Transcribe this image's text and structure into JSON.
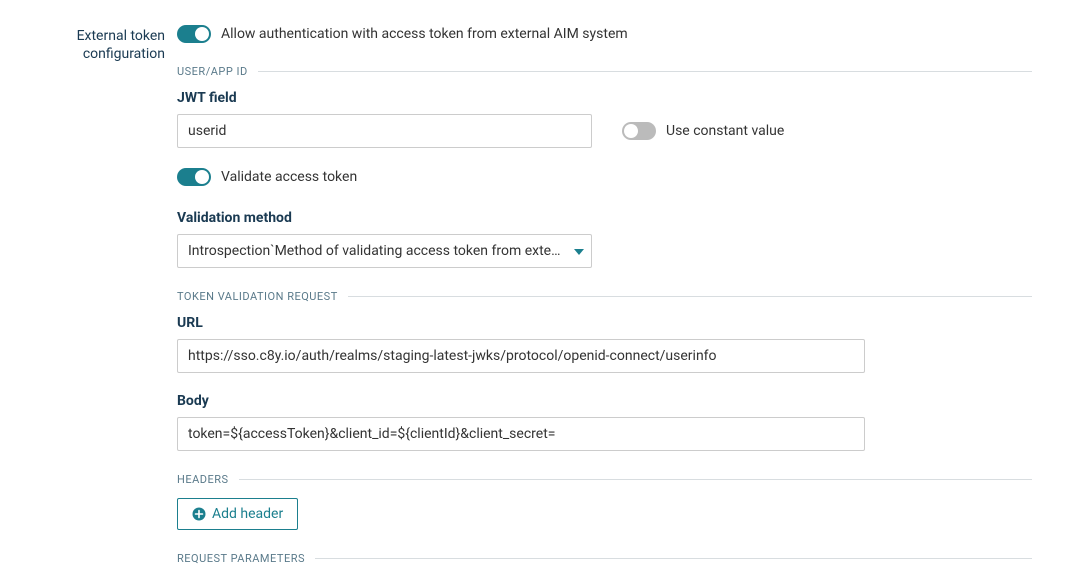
{
  "title": "External token configuration",
  "allowAuth": {
    "label": "Allow authentication with access token from external AIM system",
    "on": true
  },
  "sections": {
    "userAppId": "USER/APP ID",
    "tokenValidationRequest": "TOKEN VALIDATION REQUEST",
    "headers": "HEADERS",
    "requestParameters": "REQUEST PARAMETERS"
  },
  "jwtField": {
    "label": "JWT field",
    "value": "userid"
  },
  "useConstant": {
    "label": "Use constant value",
    "on": false
  },
  "validateToken": {
    "label": "Validate access token",
    "on": true
  },
  "validationMethod": {
    "label": "Validation method",
    "value": "Introspection`Method of validating access token from external AIM system"
  },
  "url": {
    "label": "URL",
    "value": "https://sso.c8y.io/auth/realms/staging-latest-jwks/protocol/openid-connect/userinfo"
  },
  "body": {
    "label": "Body",
    "value": "token=${accessToken}&client_id=${clientId}&client_secret="
  },
  "addHeader": "Add header"
}
